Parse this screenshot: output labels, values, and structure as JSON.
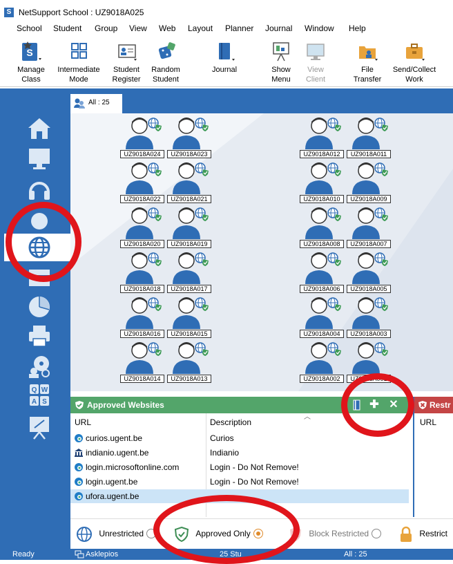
{
  "window": {
    "title": "NetSupport School : UZ9018A025"
  },
  "menu": [
    "School",
    "Student",
    "Group",
    "View",
    "Web",
    "Layout",
    "Planner",
    "Journal",
    "Window",
    "Help"
  ],
  "toolbar": {
    "manage_class": "Manage\nClass",
    "intermediate_mode": "Intermediate\nMode",
    "student_register": "Student\nRegister",
    "random_student": "Random\nStudent",
    "journal": "Journal",
    "show_menu": "Show\nMenu",
    "view_client": "View\nClient",
    "file_transfer": "File\nTransfer",
    "send_collect": "Send/Collect\nWork"
  },
  "tab": {
    "label": "All : 25"
  },
  "clients": [
    "UZ9018A024",
    "UZ9018A023",
    "UZ9018A012",
    "UZ9018A011",
    "UZ9018A022",
    "UZ9018A021",
    "UZ9018A010",
    "UZ9018A009",
    "UZ9018A020",
    "UZ9018A019",
    "UZ9018A008",
    "UZ9018A007",
    "UZ9018A018",
    "UZ9018A017",
    "UZ9018A006",
    "UZ9018A005",
    "UZ9018A016",
    "UZ9018A015",
    "UZ9018A004",
    "UZ9018A003",
    "UZ9018A014",
    "UZ9018A013",
    "UZ9018A002",
    "UZ9018A001"
  ],
  "approved": {
    "title": "Approved Websites",
    "col_url": "URL",
    "col_desc": "Description",
    "rows": [
      {
        "url": "curios.ugent.be",
        "desc": "Curios"
      },
      {
        "url": "indianio.ugent.be",
        "desc": "Indianio"
      },
      {
        "url": "login.microsoftonline.com",
        "desc": "Login - Do Not Remove!"
      },
      {
        "url": "login.ugent.be",
        "desc": "Login - Do Not Remove!"
      },
      {
        "url": "ufora.ugent.be",
        "desc": ""
      }
    ]
  },
  "restricted": {
    "title": "Restr",
    "col_url": "URL"
  },
  "modes": {
    "unrestricted": "Unrestricted",
    "approved_only": "Approved Only",
    "block_restricted": "Block Restricted",
    "restrict": "Restrict"
  },
  "status": {
    "ready": "Ready",
    "user": "Asklepios",
    "students": "25 Stu",
    "all": "All : 25"
  },
  "colors": {
    "accent": "#2f6db5",
    "approved": "#53a56a",
    "restricted": "#c44545",
    "annotation": "#e0151b"
  }
}
